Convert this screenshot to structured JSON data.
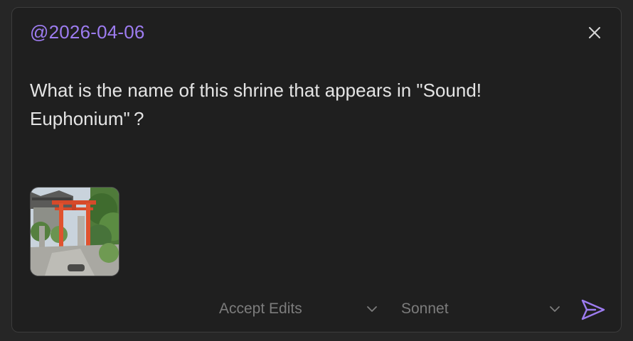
{
  "composer": {
    "mention": "@2026-04-06",
    "message": "What is the name of this shrine that appears in \"Sound! Euphonium\" ?",
    "attachment_icon": "image-thumbnail",
    "close_icon": "close-icon",
    "mode_select": {
      "value": "Accept Edits"
    },
    "model_select": {
      "value": "Sonnet"
    },
    "send_icon": "send-icon"
  },
  "colors": {
    "accent": "#9d7cf0",
    "panel_bg": "#1f1f1f",
    "text": "#e4e4e4",
    "muted_text": "#7c7c7c"
  }
}
